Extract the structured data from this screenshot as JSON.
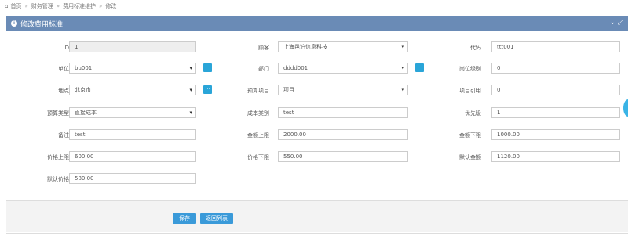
{
  "breadcrumb": {
    "items": [
      "首页",
      "财务管理",
      "费用标准维护",
      "修改"
    ]
  },
  "panel": {
    "title": "修改费用标准"
  },
  "form": {
    "id": {
      "label": "ID",
      "value": "1"
    },
    "customer": {
      "label": "顾客",
      "value": "上海邑泊信息科技"
    },
    "code": {
      "label": "代码",
      "value": "ttt001"
    },
    "unit": {
      "label": "单位",
      "value": "bu001"
    },
    "department": {
      "label": "部门",
      "value": "dddd001"
    },
    "position_level": {
      "label": "岗位级别",
      "value": "0"
    },
    "location": {
      "label": "地点",
      "value": "北京市"
    },
    "budget_project": {
      "label": "预算项目",
      "value": "项目"
    },
    "project_ref": {
      "label": "项目引用",
      "value": "0"
    },
    "budget_type": {
      "label": "预算类型",
      "value": "直接成本"
    },
    "cost_category": {
      "label": "成本类别",
      "value": "test"
    },
    "priority": {
      "label": "优先级",
      "value": "1"
    },
    "remark": {
      "label": "备注",
      "value": "test"
    },
    "amount_upper": {
      "label": "金额上限",
      "value": "2000.00"
    },
    "amount_lower": {
      "label": "金额下限",
      "value": "1000.00"
    },
    "price_upper": {
      "label": "价格上限",
      "value": "600.00"
    },
    "price_lower": {
      "label": "价格下限",
      "value": "550.00"
    },
    "default_amount": {
      "label": "默认金额",
      "value": "1120.00"
    },
    "default_price": {
      "label": "默认价格",
      "value": "580.00"
    }
  },
  "buttons": {
    "save": "保存",
    "back": "返回列表",
    "pick": "..."
  },
  "colors": {
    "header_bg": "#6a8bb6",
    "button_bg": "#3a9ad9",
    "pick_bg": "#2aa5d8"
  }
}
